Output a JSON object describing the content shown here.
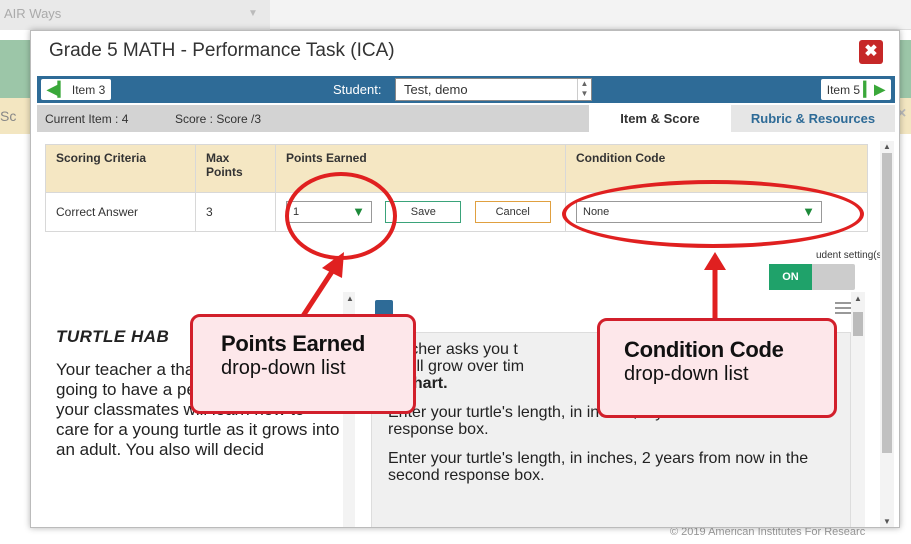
{
  "background": {
    "app_tab": "AIR Ways",
    "left_clip": "Sc"
  },
  "modal": {
    "title": "Grade 5 MATH - Performance Task (ICA)",
    "close": "✖",
    "prev_item": "Item 3",
    "next_item": "Item 5",
    "student_label": "Student:",
    "student_value": "Test, demo",
    "current_item": "Current Item : 4",
    "score": "Score : Score /3",
    "tabs": [
      "Item & Score",
      "Rubric & Resources"
    ]
  },
  "table": {
    "headers": [
      "Scoring Criteria",
      "Max Points",
      "Points Earned",
      "Condition Code"
    ],
    "row": {
      "criteria": "Correct Answer",
      "max": "3",
      "points_selected": "1",
      "save": "Save",
      "cancel": "Cancel",
      "condition_selected": "None"
    }
  },
  "student_setting": "udent setting(s)",
  "toggle_on": "ON",
  "passage": {
    "title": "TURTLE HAB",
    "text": "Your teacher a that your class is going to have a pet turtle. You and your classmates will learn how to care for a young turtle as it grows into an adult. You also will decid"
  },
  "question": {
    "line1": "teacher asks you t",
    "line2": "e will grow over tim",
    "line3": "s Chart.",
    "p2": "Enter your turtle's length, in inches, 1 year from now in the first response box.",
    "p3": "Enter your turtle's length, in inches, 2 years from now in the second response box."
  },
  "callouts": [
    {
      "title": "Points Earned",
      "sub": "drop-down list"
    },
    {
      "title": "Condition Code",
      "sub": "drop-down list"
    }
  ],
  "footer": "© 2019 American Institutes For Researc",
  "colors": {
    "annotation": "#e02020",
    "accent": "#2e6b97",
    "header_bg": "#f5e7c3"
  }
}
